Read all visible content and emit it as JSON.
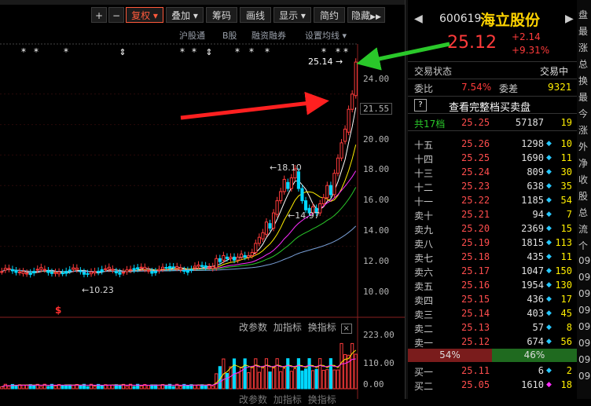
{
  "toolbar": {
    "plus": "+",
    "minus": "−",
    "fuquan": "复权",
    "diejia": "叠加",
    "chouma": "筹码",
    "huaxian": "画线",
    "xianshi": "显示",
    "jianyue": "简约",
    "yincang": "隐藏",
    "arrow_right": "▶▶",
    "chevron": "▾"
  },
  "subbar": {
    "hgt": "沪股通",
    "bgu": "B股",
    "rzrq": "融资融券",
    "ma_setting": "设置均线"
  },
  "chart_overlay": {
    "last_price": "25.14",
    "high_marker": "18.10",
    "low_marker": "14.97",
    "bottom_marker": "10.23",
    "dollar": "$",
    "star": "*"
  },
  "price_axis": [
    "24.00",
    "21.55",
    "20.00",
    "18.00",
    "16.00",
    "14.00",
    "12.00",
    "10.00"
  ],
  "volume_bar": {
    "modify": "改参数",
    "add": "加指标",
    "change": "换指标",
    "close": "×",
    "ticks": [
      "223.00",
      "110.00",
      "0.00"
    ],
    "bottom_labels": [
      "改参数",
      "加指标",
      "换指标"
    ]
  },
  "quote": {
    "code": "600619",
    "name": "海立股份",
    "price": "25.12",
    "change": "+2.14",
    "pct": "+9.31%",
    "prev": "◀",
    "next": "▶",
    "status_label": "交易状态",
    "status_value": "交易中",
    "weibi_label": "委比",
    "weibi_value": "7.54%",
    "weicha_label": "委差",
    "weicha_value": "9321",
    "full_book": "查看完整档买卖盘",
    "help": "?",
    "total_label": "共17档",
    "total_price": "25.25",
    "total_vol": "57187",
    "total_num": "19",
    "ratio_left": "54%",
    "ratio_right": "46%"
  },
  "sell_levels": [
    {
      "label": "十五",
      "price": "25.26",
      "vol": "1298",
      "num": "10"
    },
    {
      "label": "十四",
      "price": "25.25",
      "vol": "1690",
      "num": "11"
    },
    {
      "label": "十三",
      "price": "25.24",
      "vol": "809",
      "num": "30"
    },
    {
      "label": "十二",
      "price": "25.23",
      "vol": "638",
      "num": "35"
    },
    {
      "label": "十一",
      "price": "25.22",
      "vol": "1185",
      "num": "54"
    },
    {
      "label": "卖十",
      "price": "25.21",
      "vol": "94",
      "num": "7"
    },
    {
      "label": "卖九",
      "price": "25.20",
      "vol": "2369",
      "num": "15"
    },
    {
      "label": "卖八",
      "price": "25.19",
      "vol": "1815",
      "num": "113"
    },
    {
      "label": "卖七",
      "price": "25.18",
      "vol": "435",
      "num": "11"
    },
    {
      "label": "卖六",
      "price": "25.17",
      "vol": "1047",
      "num": "150"
    },
    {
      "label": "卖五",
      "price": "25.16",
      "vol": "1954",
      "num": "130"
    },
    {
      "label": "卖四",
      "price": "25.15",
      "vol": "436",
      "num": "17"
    },
    {
      "label": "卖三",
      "price": "25.14",
      "vol": "403",
      "num": "45"
    },
    {
      "label": "卖二",
      "price": "25.13",
      "vol": "57",
      "num": "8"
    },
    {
      "label": "卖一",
      "price": "25.12",
      "vol": "674",
      "num": "56"
    }
  ],
  "buy_levels": [
    {
      "label": "买一",
      "price": "25.11",
      "vol": "6",
      "num": "2"
    },
    {
      "label": "买二",
      "price": "25.05",
      "vol": "1610",
      "num": "18"
    }
  ],
  "far_right": [
    "盘",
    "最",
    "涨",
    "总",
    "换",
    "最",
    "今",
    "涨",
    "外",
    "净",
    "收",
    "股",
    "总",
    "流",
    "个",
    "09",
    "09",
    "09",
    "09",
    "09",
    "09",
    "09",
    "09"
  ],
  "colors": {
    "up": "#ff3b3b",
    "down": "#00d8ff",
    "quote_name": "#ffd400",
    "green_arrow": "#2ac82a",
    "red_arrow": "#ff2020"
  }
}
